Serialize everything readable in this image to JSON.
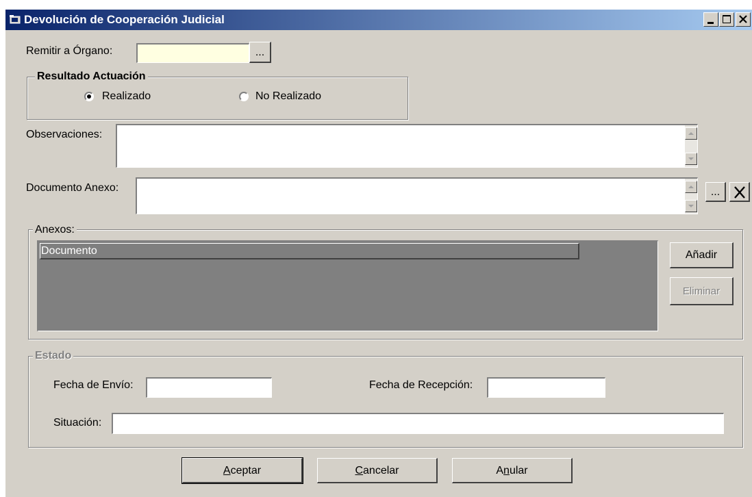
{
  "window": {
    "title": "Devolución de Cooperación Judicial"
  },
  "remitir": {
    "label": "Remitir a Órgano:",
    "value": "",
    "browse_label": "..."
  },
  "resultado": {
    "legend": "Resultado Actuación",
    "options": [
      {
        "label": "Realizado",
        "selected": true
      },
      {
        "label": "No Realizado",
        "selected": false
      }
    ]
  },
  "observaciones": {
    "label": "Observaciones:",
    "value": ""
  },
  "documento_anexo": {
    "label": "Documento Anexo:",
    "value": "",
    "browse_label": "...",
    "clear_label": "X"
  },
  "anexos": {
    "legend": "Anexos:",
    "column_header": "Documento",
    "rows": [],
    "add_label": "Añadir",
    "remove_label": "Eliminar"
  },
  "estado": {
    "legend": "Estado",
    "fecha_envio_label": "Fecha de Envío:",
    "fecha_envio_value": "",
    "fecha_recepcion_label": "Fecha de Recepción:",
    "fecha_recepcion_value": "",
    "situacion_label": "Situación:",
    "situacion_value": ""
  },
  "buttons": {
    "aceptar_prefix": "",
    "aceptar_mnemonic": "A",
    "aceptar_rest": "ceptar",
    "cancelar_prefix": "",
    "cancelar_mnemonic": "C",
    "cancelar_rest": "ancelar",
    "anular_prefix": "A",
    "anular_mnemonic": "n",
    "anular_rest": "ular"
  },
  "colors": {
    "titlebar_start": "#0a246a",
    "titlebar_end": "#a6caf0",
    "face": "#d4d0c8",
    "required_field": "#ffffe1",
    "list_background": "#808080"
  }
}
